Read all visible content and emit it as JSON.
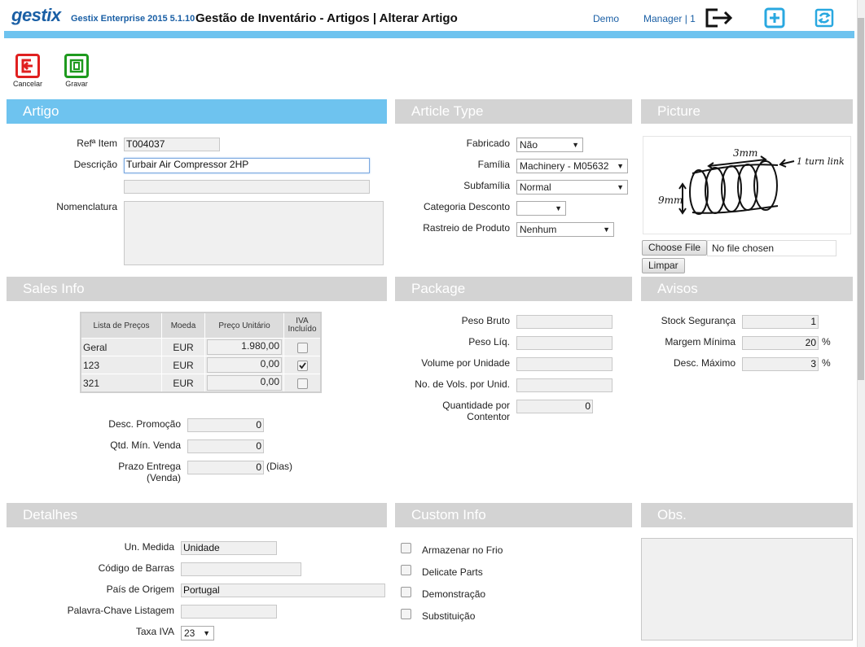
{
  "header": {
    "logo": "gestix",
    "app_name": "Gestix Enterprise 2015 5.1.10",
    "page_title": "Gestão de Inventário - Artigos | Alterar Artigo",
    "company": "Demo",
    "user": "Manager | 1"
  },
  "toolbar": {
    "cancel_label": "Cancelar",
    "save_label": "Gravar"
  },
  "artigo": {
    "title": "Artigo",
    "ref_label": "Refª Item",
    "ref_value": "T004037",
    "desc_label": "Descrição",
    "desc_value": "Turbair Air Compressor 2HP",
    "desc2_value": "",
    "nomenclatura_label": "Nomenclatura"
  },
  "article_type": {
    "title": "Article Type",
    "fabricado_label": "Fabricado",
    "fabricado_value": "Não",
    "familia_label": "Família",
    "familia_value": "Machinery - M05632",
    "subfamilia_label": "Subfamília",
    "subfamilia_value": "Normal",
    "categoria_label": "Categoria Desconto",
    "categoria_value": "",
    "rastreio_label": "Rastreio de Produto",
    "rastreio_value": "Nenhum"
  },
  "picture": {
    "title": "Picture",
    "choose_file": "Choose File",
    "no_file": "No file chosen",
    "clear": "Limpar",
    "sketch_labels": [
      "3mm",
      "1 turn link",
      "9mm"
    ]
  },
  "sales_info": {
    "title": "Sales Info",
    "columns": [
      "Lista de Preços",
      "Moeda",
      "Preço Unitário",
      "IVA Incluído"
    ],
    "rows": [
      {
        "list": "Geral",
        "currency": "EUR",
        "price": "1.980,00",
        "vat_included": false
      },
      {
        "list": "123",
        "currency": "EUR",
        "price": "0,00",
        "vat_included": true
      },
      {
        "list": "321",
        "currency": "EUR",
        "price": "0,00",
        "vat_included": false
      }
    ],
    "promo_label": "Desc. Promoção",
    "promo_value": "0",
    "min_qty_label": "Qtd. Mín. Venda",
    "min_qty_value": "0",
    "lead_label_1": "Prazo Entrega",
    "lead_label_2": "(Venda)",
    "lead_value": "0",
    "lead_unit": "(Dias)"
  },
  "package": {
    "title": "Package",
    "gross_label": "Peso Bruto",
    "gross_value": "",
    "net_label": "Peso Líq.",
    "net_value": "",
    "volume_label": "Volume por Unidade",
    "volume_value": "",
    "vols_label": "No. de Vols. por Unid.",
    "vols_value": "",
    "qty_label_1": "Quantidade por",
    "qty_label_2": "Contentor",
    "qty_value": "0"
  },
  "avisos": {
    "title": "Avisos",
    "stock_label": "Stock Segurança",
    "stock_value": "1",
    "margin_label": "Margem Mínima",
    "margin_value": "20",
    "margin_unit": "%",
    "disc_label": "Desc. Máximo",
    "disc_value": "3",
    "disc_unit": "%"
  },
  "detalhes": {
    "title": "Detalhes",
    "unit_label": "Un. Medida",
    "unit_value": "Unidade",
    "barcode_label": "Código de Barras",
    "barcode_value": "",
    "origin_label": "País de Origem",
    "origin_value": "Portugal",
    "keyword_label": "Palavra-Chave Listagem",
    "keyword_value": "",
    "vat_label": "Taxa IVA",
    "vat_value": "23"
  },
  "custom_info": {
    "title": "Custom Info",
    "items": [
      "Armazenar no Frio",
      "Delicate Parts",
      "Demonstração",
      "Substituição"
    ]
  },
  "obs": {
    "title": "Obs."
  },
  "colors": {
    "accent": "#6ec3ef",
    "section_grey": "#d3d3d3",
    "brand": "#1a5fa5",
    "cancel": "#e02020",
    "save": "#1e9a1e"
  }
}
